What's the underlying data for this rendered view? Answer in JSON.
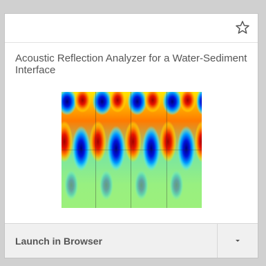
{
  "card": {
    "title": "Acoustic Reflection Analyzer for a Water-Sediment Interface",
    "favorite_icon": "star-outline-icon",
    "thumbnail": {
      "kind": "acoustic-pressure-field-plot",
      "colormap": [
        "#0000c8",
        "#00b4ff",
        "#8cf08c",
        "#ffe600",
        "#dc0000"
      ]
    },
    "footer": {
      "launch_label": "Launch in Browser",
      "dropdown_icon": "caret-down-icon"
    }
  },
  "colors": {
    "background": "#d0d0d0",
    "card": "#ffffff",
    "footer": "#f0f0f0",
    "text": "#555555"
  }
}
